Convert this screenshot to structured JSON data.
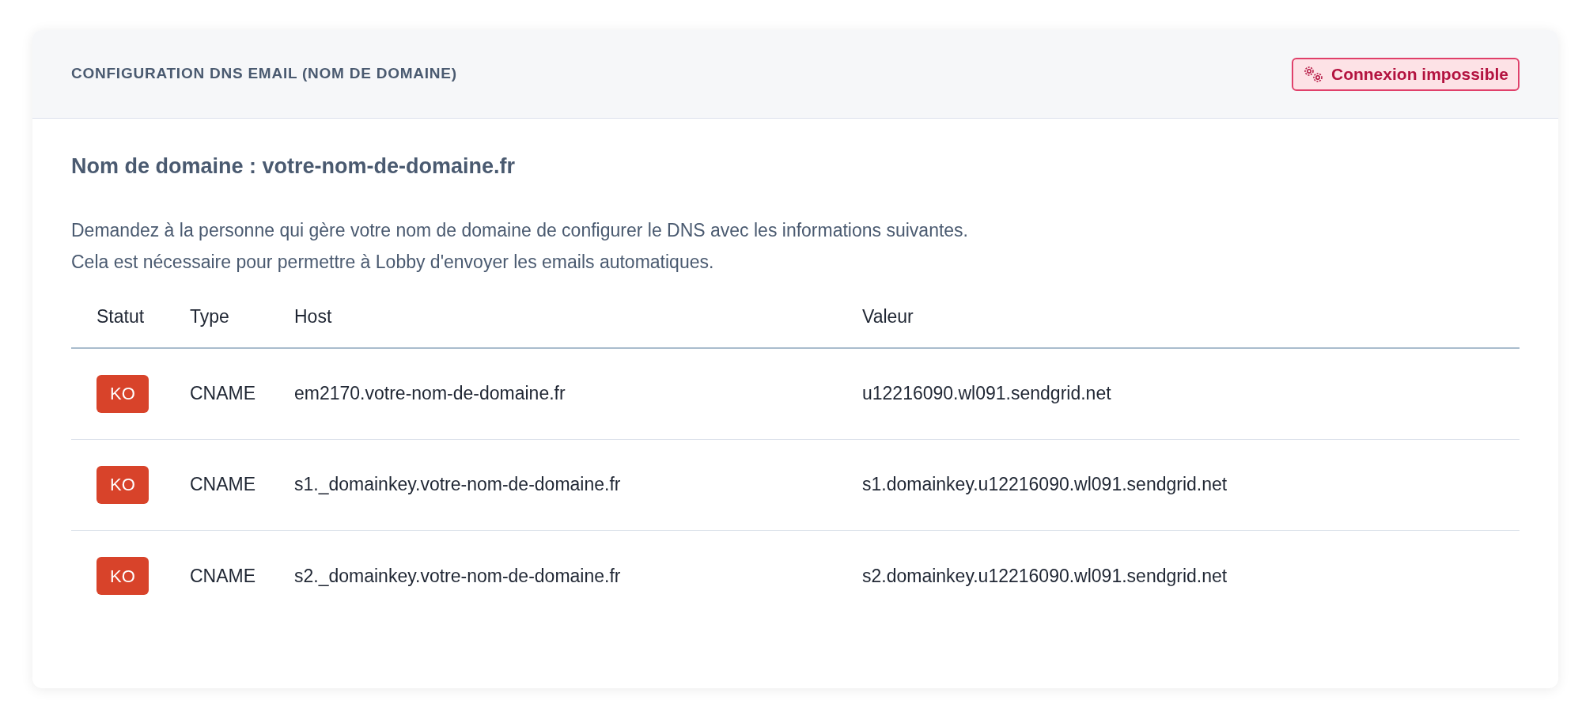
{
  "card": {
    "title": "CONFIGURATION DNS EMAIL (NOM DE DOMAINE)",
    "status_badge": {
      "label": "Connexion impossible",
      "kind": "error"
    }
  },
  "domain_heading": "Nom de domaine : votre-nom-de-domaine.fr",
  "instructions": [
    "Demandez à la personne qui gère votre nom de domaine de configurer le DNS avec les informations suivantes.",
    "Cela est nécessaire pour permettre à Lobby d'envoyer les emails automatiques."
  ],
  "table": {
    "columns": [
      "Statut",
      "Type",
      "Host",
      "Valeur"
    ],
    "rows": [
      {
        "status": {
          "label": "KO",
          "kind": "error"
        },
        "type": "CNAME",
        "host": "em2170.votre-nom-de-domaine.fr",
        "value": "u12216090.wl091.sendgrid.net"
      },
      {
        "status": {
          "label": "KO",
          "kind": "error"
        },
        "type": "CNAME",
        "host": "s1._domainkey.votre-nom-de-domaine.fr",
        "value": "s1.domainkey.u12216090.wl091.sendgrid.net"
      },
      {
        "status": {
          "label": "KO",
          "kind": "error"
        },
        "type": "CNAME",
        "host": "s2._domainkey.votre-nom-de-domaine.fr",
        "value": "s2.domainkey.u12216090.wl091.sendgrid.net"
      }
    ]
  }
}
